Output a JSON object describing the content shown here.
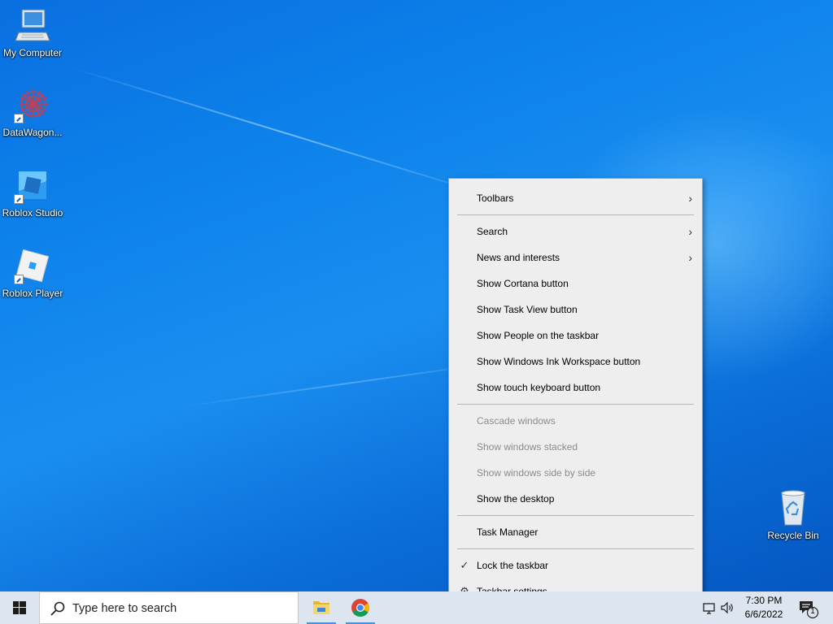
{
  "desktop": {
    "icons": [
      {
        "label": "My Computer",
        "icon": "computer-icon"
      },
      {
        "label": "DataWagon...",
        "icon": "datawagon-icon"
      },
      {
        "label": "Roblox Studio",
        "icon": "roblox-studio-icon"
      },
      {
        "label": "Roblox Player",
        "icon": "roblox-player-icon"
      },
      {
        "label": "Recycle Bin",
        "icon": "recycle-bin-icon"
      }
    ]
  },
  "context_menu": {
    "toolbars": "Toolbars",
    "search": "Search",
    "news": "News and interests",
    "cortana": "Show Cortana button",
    "task_view": "Show Task View button",
    "people": "Show People on the taskbar",
    "ink": "Show Windows Ink Workspace button",
    "touch_keyboard": "Show touch keyboard button",
    "cascade": "Cascade windows",
    "stacked": "Show windows stacked",
    "side_by_side": "Show windows side by side",
    "show_desktop": "Show the desktop",
    "task_manager": "Task Manager",
    "lock_taskbar": "Lock the taskbar",
    "lock_checked": true,
    "taskbar_settings": "Taskbar settings"
  },
  "taskbar": {
    "search_placeholder": "Type here to search",
    "pinned": [
      {
        "name": "File Explorer",
        "icon": "folder-icon"
      },
      {
        "name": "Google Chrome",
        "icon": "chrome-icon"
      }
    ],
    "time": "7:30 PM",
    "date": "6/6/2022",
    "notification_count": "1"
  },
  "colors": {
    "taskbar_bg": "#dde6f0",
    "menu_bg": "#eeeeee",
    "accent": "#0078d7"
  }
}
